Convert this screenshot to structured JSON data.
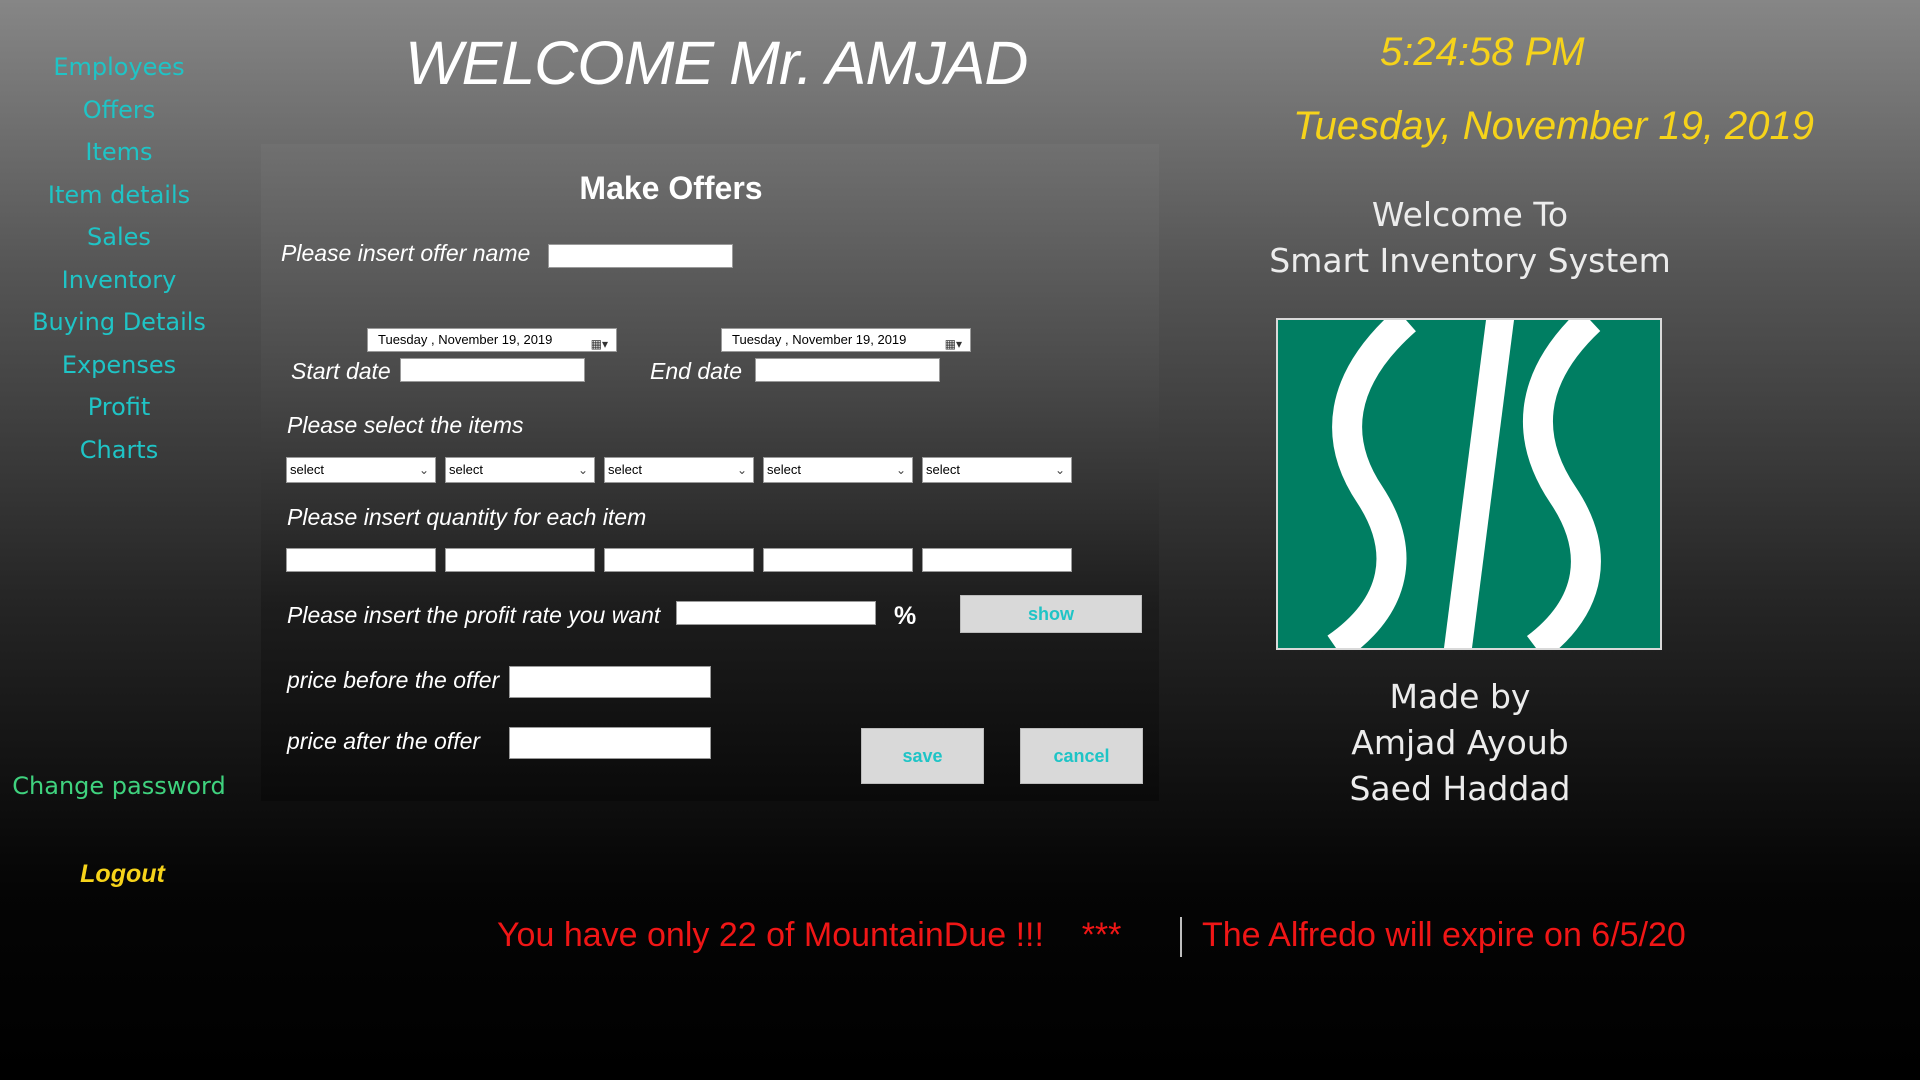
{
  "sidebar": {
    "items": [
      {
        "label": "Employees"
      },
      {
        "label": "Offers"
      },
      {
        "label": "Items"
      },
      {
        "label": "Item details"
      },
      {
        "label": "Sales"
      },
      {
        "label": "Inventory"
      },
      {
        "label": "Buying Details"
      },
      {
        "label": "Expenses"
      },
      {
        "label": "Profit"
      },
      {
        "label": "Charts"
      }
    ],
    "change_password": "Change password",
    "logout": "Logout"
  },
  "header": {
    "welcome": "WELCOME Mr. AMJAD",
    "time": "5:24:58 PM",
    "date": "Tuesday, November 19, 2019"
  },
  "info": {
    "welcome_line1": "Welcome To",
    "welcome_line2": "Smart Inventory System",
    "logo_text": "SIS",
    "made_by": "Made by",
    "author1": "Amjad Ayoub",
    "author2": "Saed Haddad"
  },
  "form": {
    "title": "Make Offers",
    "offer_name_label": "Please insert offer name",
    "offer_name_value": "",
    "start_date_picker": "Tuesday  , November 19, 2019",
    "end_date_picker": "Tuesday  , November 19, 2019",
    "start_date_label": "Start date",
    "end_date_label": "End date",
    "start_date_value": "",
    "end_date_value": "",
    "select_items_label": "Please select the items",
    "item_selects": [
      "select",
      "select",
      "select",
      "select",
      "select"
    ],
    "quantity_label": "Please insert quantity for each item",
    "quantity_values": [
      "",
      "",
      "",
      "",
      ""
    ],
    "profit_rate_label": "Please insert the profit rate you want",
    "profit_rate_value": "",
    "percent_symbol": "%",
    "show_button": "show",
    "price_before_label": "price before the offer",
    "price_before_value": "",
    "price_after_label": "price after the offer",
    "price_after_value": "",
    "save_button": "save",
    "cancel_button": "cancel"
  },
  "ticker": {
    "message1": "You have only 22 of MountainDue !!!    ***",
    "message2": "The Alfredo will expire on 6/5/20"
  },
  "colors": {
    "nav_text": "#1fc4c6",
    "change_password": "#3fd27e",
    "accent_yellow": "#f6d31a",
    "ticker_red": "#f01616",
    "logo_green": "#007e62"
  },
  "icons": {
    "calendar": "calendar-icon",
    "dropdown": "chevron-down-icon",
    "logo": "sis-logo"
  }
}
